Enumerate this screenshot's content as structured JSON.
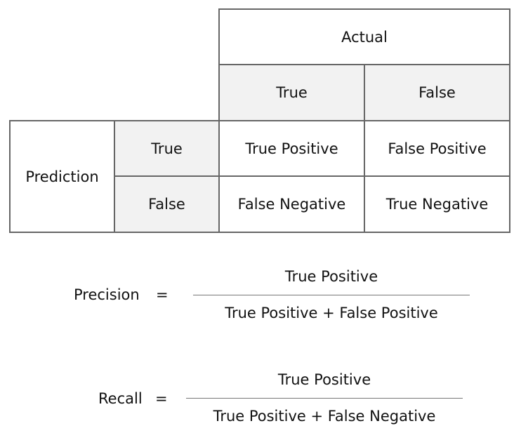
{
  "matrix": {
    "actual_header": "Actual",
    "actual_true": "True",
    "actual_false": "False",
    "prediction_header": "Prediction",
    "pred_true": "True",
    "pred_false": "False",
    "tp": "True Positive",
    "fp": "False Positive",
    "fn": "False Negative",
    "tn": "True Negative"
  },
  "precision": {
    "label": "Precision",
    "equals": "=",
    "numerator": "True Positive",
    "denominator": "True Positive + False Positive"
  },
  "recall": {
    "label": "Recall",
    "equals": "=",
    "numerator": "True Positive",
    "denominator": "True Positive + False Negative"
  }
}
